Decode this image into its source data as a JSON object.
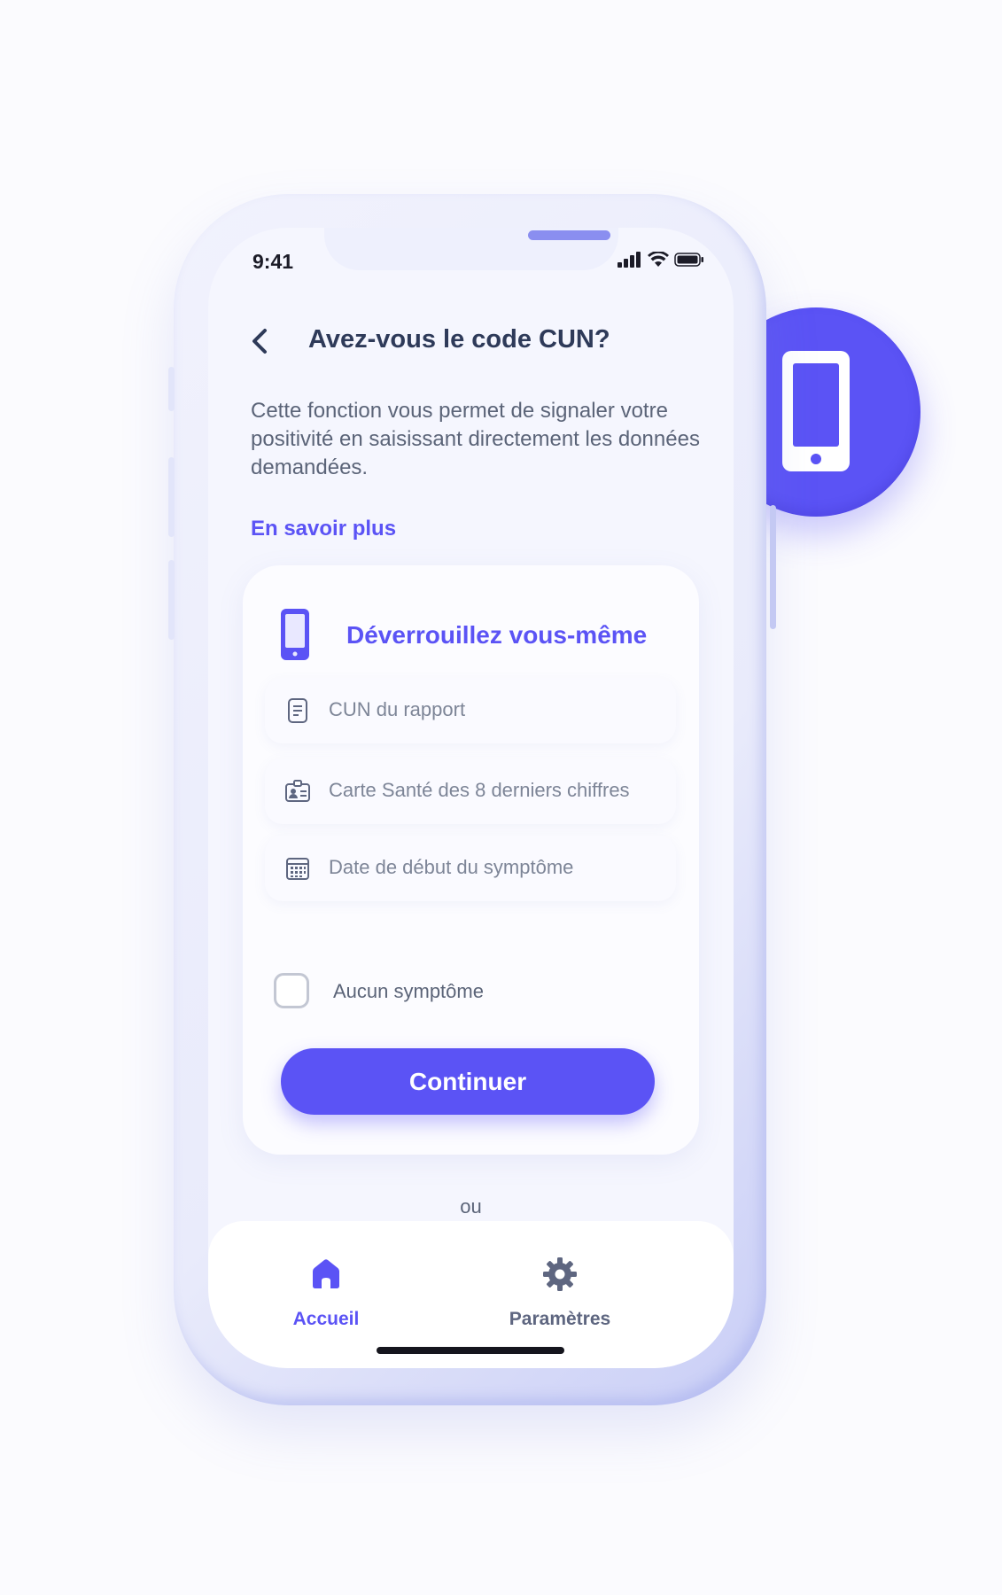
{
  "status_bar": {
    "time": "9:41"
  },
  "header": {
    "title": "Avez-vous le code CUN?"
  },
  "intro": {
    "description": "Cette fonction vous permet de signaler votre positivité en saisissant directement les données demandées.",
    "learn_more": "En savoir plus"
  },
  "card": {
    "title": "Déverrouillez vous-même",
    "fields": [
      {
        "placeholder": "CUN du rapport",
        "icon": "document-icon"
      },
      {
        "placeholder": "Carte Santé des 8 derniers chiffres",
        "icon": "id-card-icon"
      },
      {
        "placeholder": "Date de début du symptôme",
        "icon": "calendar-icon"
      }
    ],
    "checkbox_label": "Aucun symptôme",
    "checkbox_checked": false,
    "cta_label": "Continuer"
  },
  "or_text": "ou",
  "tabbar": {
    "items": [
      {
        "label": "Accueil",
        "icon": "home-icon",
        "active": true
      },
      {
        "label": "Paramètres",
        "icon": "gear-icon",
        "active": false
      }
    ]
  },
  "colors": {
    "accent": "#5b53f5",
    "title": "#2e3a59",
    "muted": "#7d8597"
  }
}
